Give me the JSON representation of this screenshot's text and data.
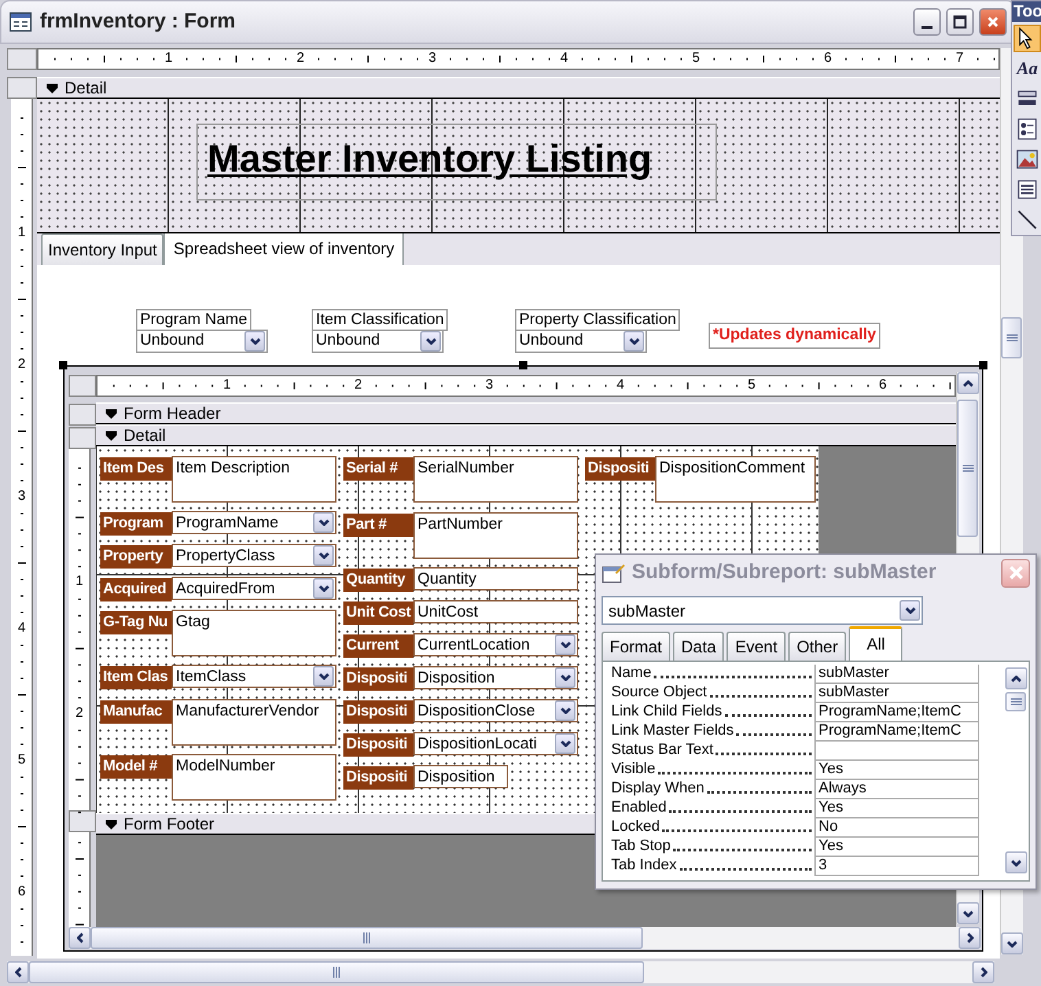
{
  "window": {
    "title": "frmInventory : Form"
  },
  "toolbox": {
    "title": "Too",
    "tools": [
      {
        "kind": "pointer",
        "selected": true
      },
      {
        "kind": "label",
        "glyph": "Aa",
        "selected": false
      },
      {
        "kind": "toggle",
        "selected": false
      },
      {
        "kind": "option",
        "selected": false
      },
      {
        "kind": "image",
        "selected": false
      },
      {
        "kind": "list",
        "selected": false
      },
      {
        "kind": "line",
        "selected": false
      }
    ]
  },
  "ruler": [
    "1",
    "2",
    "3",
    "4",
    "5",
    "6",
    "7"
  ],
  "vertical_ruler": [
    "1",
    "2",
    "3",
    "4",
    "5",
    "6"
  ],
  "detail_section": {
    "label": "Detail"
  },
  "title_label": "Master Inventory Listing",
  "tabs": [
    {
      "label": "Inventory Input",
      "selected": false
    },
    {
      "label": "Spreadsheet view of inventory",
      "selected": true
    }
  ],
  "filters": [
    {
      "label": "Program Name",
      "value": "Unbound"
    },
    {
      "label": "Item Classification",
      "value": "Unbound"
    },
    {
      "label": "Property Classification",
      "value": "Unbound"
    }
  ],
  "note": "*Updates dynamically",
  "subform": {
    "ruler": [
      "1",
      "2",
      "3",
      "4",
      "5",
      "6"
    ],
    "vertical_ruler": [
      "1",
      "2"
    ],
    "header": "Form Header",
    "detail": "Detail",
    "footer": "Form Footer",
    "columns": [
      [
        {
          "label": "Item Des",
          "value": "Item Description",
          "kind": "textbox"
        },
        {
          "label": "Program",
          "value": "ProgramName",
          "kind": "combo"
        },
        {
          "label": "Property",
          "value": "PropertyClass",
          "kind": "combo"
        },
        {
          "label": "Acquired",
          "value": "AcquiredFrom",
          "kind": "combo"
        },
        {
          "label": "G-Tag Nu",
          "value": "Gtag",
          "kind": "textbox"
        },
        {
          "label": "Item Clas",
          "value": "ItemClass",
          "kind": "combo"
        },
        {
          "label": "Manufac",
          "value": "ManufacturerVendor",
          "kind": "textbox"
        },
        {
          "label": "Model #",
          "value": "ModelNumber",
          "kind": "textbox"
        }
      ],
      [
        {
          "label": "Serial #",
          "value": "SerialNumber",
          "kind": "textbox"
        },
        {
          "label": "Part #",
          "value": "PartNumber",
          "kind": "textbox"
        },
        {
          "label": "Quantity",
          "value": "Quantity",
          "kind": "textbox"
        },
        {
          "label": "Unit Cost",
          "value": "UnitCost",
          "kind": "textbox"
        },
        {
          "label": "Current",
          "value": "CurrentLocation",
          "kind": "combo"
        },
        {
          "label": "Dispositi",
          "value": "Disposition",
          "kind": "combo"
        },
        {
          "label": "Dispositi",
          "value": "DispositionClose",
          "kind": "combo"
        },
        {
          "label": "Dispositi",
          "value": "DispositionLocati",
          "kind": "combo"
        },
        {
          "label": "Dispositi",
          "value": "Disposition",
          "kind": "textbox"
        }
      ],
      [
        {
          "label": "Dispositi",
          "value": "DispositionComment",
          "kind": "textbox"
        }
      ]
    ]
  },
  "property_sheet": {
    "title": "Subform/Subreport: subMaster",
    "object": "subMaster",
    "tabs": [
      {
        "label": "Format",
        "selected": false
      },
      {
        "label": "Data",
        "selected": false
      },
      {
        "label": "Event",
        "selected": false
      },
      {
        "label": "Other",
        "selected": false
      },
      {
        "label": "All",
        "selected": true
      }
    ],
    "properties": [
      {
        "name": "Name",
        "value": "subMaster"
      },
      {
        "name": "Source Object",
        "value": "subMaster"
      },
      {
        "name": "Link Child Fields",
        "value": "ProgramName;ItemC"
      },
      {
        "name": "Link Master Fields",
        "value": "ProgramName;ItemC"
      },
      {
        "name": "Status Bar Text"
      },
      {
        "name": "Visible",
        "value": "Yes"
      },
      {
        "name": "Display When",
        "value": "Always"
      },
      {
        "name": "Enabled",
        "value": "Yes"
      },
      {
        "name": "Locked",
        "value": "No"
      },
      {
        "name": "Tab Stop",
        "value": "Yes"
      },
      {
        "name": "Tab Index",
        "value": "3"
      }
    ]
  }
}
